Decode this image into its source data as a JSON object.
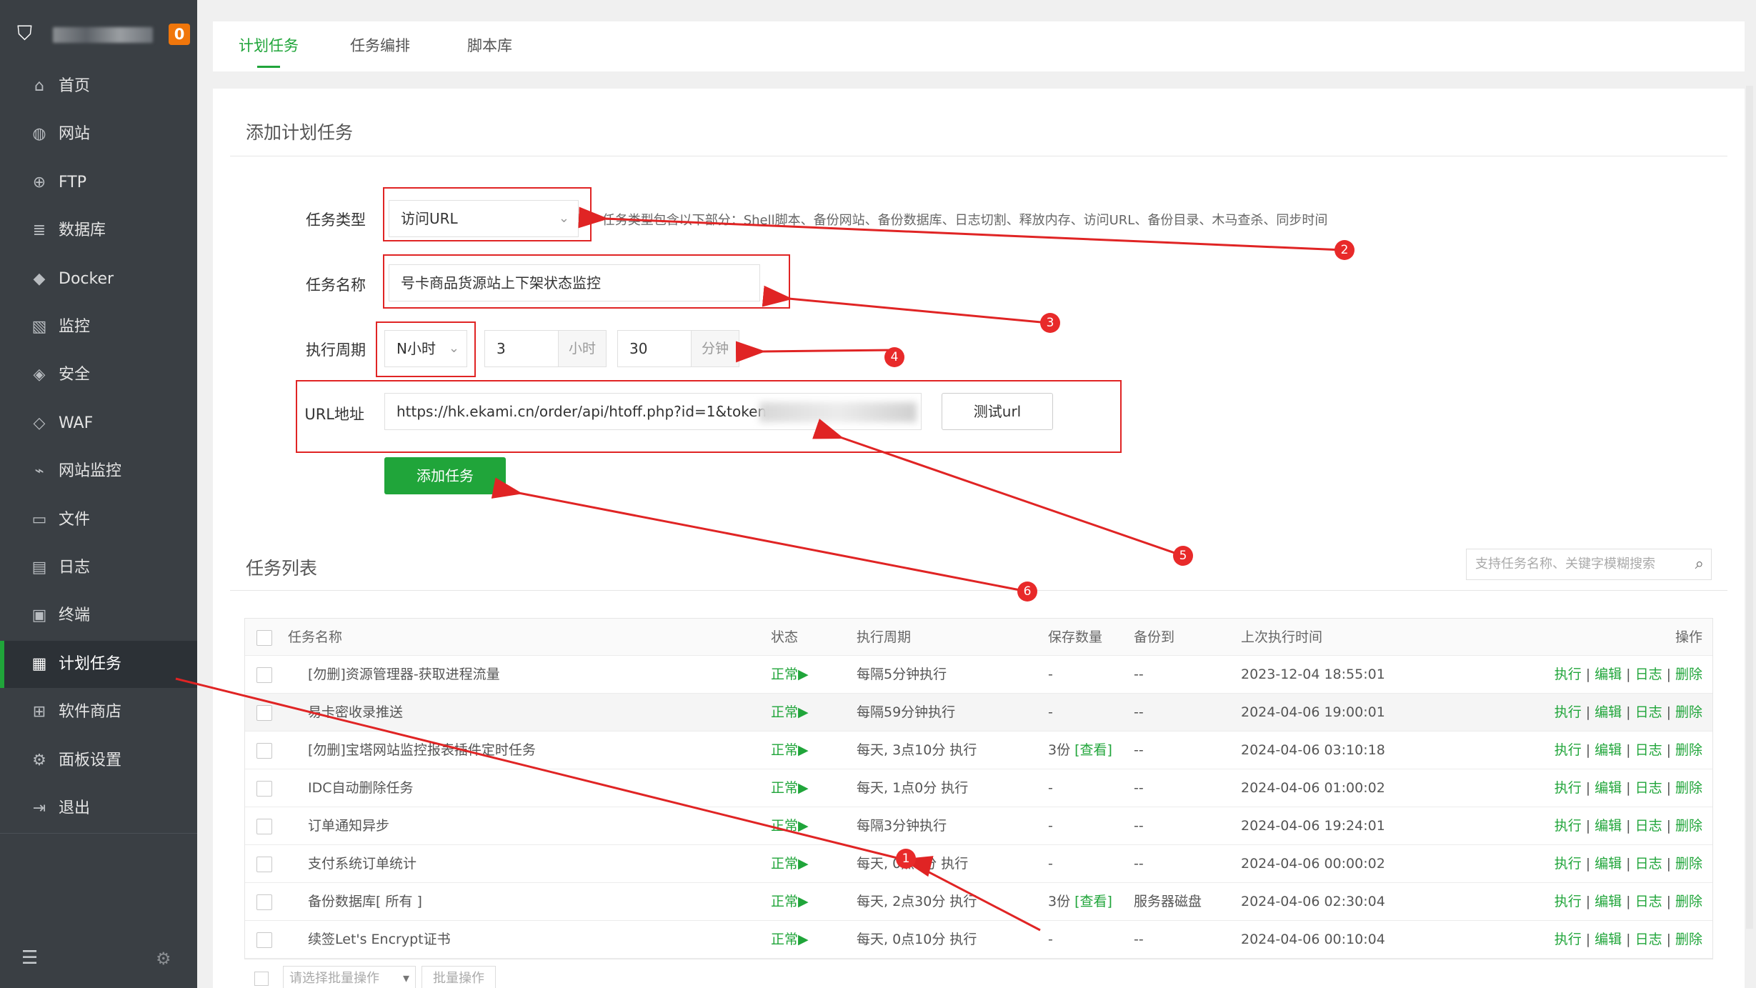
{
  "sidebar": {
    "badge": "0",
    "items": [
      {
        "label": "首页",
        "icon": "home-icon",
        "glyph": "⌂"
      },
      {
        "label": "网站",
        "icon": "globe-icon",
        "glyph": "◍"
      },
      {
        "label": "FTP",
        "icon": "ftp-icon",
        "glyph": "⊕"
      },
      {
        "label": "数据库",
        "icon": "database-icon",
        "glyph": "≣"
      },
      {
        "label": "Docker",
        "icon": "docker-icon",
        "glyph": "◆"
      },
      {
        "label": "监控",
        "icon": "monitor-icon",
        "glyph": "▧"
      },
      {
        "label": "安全",
        "icon": "shield-icon",
        "glyph": "◈"
      },
      {
        "label": "WAF",
        "icon": "waf-icon",
        "glyph": "◇"
      },
      {
        "label": "网站监控",
        "icon": "site-monitor-icon",
        "glyph": "⌁"
      },
      {
        "label": "文件",
        "icon": "folder-icon",
        "glyph": "▭"
      },
      {
        "label": "日志",
        "icon": "log-icon",
        "glyph": "▤"
      },
      {
        "label": "终端",
        "icon": "terminal-icon",
        "glyph": "▣"
      },
      {
        "label": "计划任务",
        "icon": "calendar-icon",
        "glyph": "▦",
        "active": true
      },
      {
        "label": "软件商店",
        "icon": "apps-icon",
        "glyph": "⊞"
      },
      {
        "label": "面板设置",
        "icon": "settings-icon",
        "glyph": "⚙"
      },
      {
        "label": "退出",
        "icon": "logout-icon",
        "glyph": "⇥"
      }
    ]
  },
  "tabs": [
    "计划任务",
    "任务编排",
    "脚本库"
  ],
  "form": {
    "title": "添加计划任务",
    "type_label": "任务类型",
    "type_value": "访问URL",
    "type_hint": "* 任务类型包含以下部分：Shell脚本、备份网站、备份数据库、日志切割、释放内存、访问URL、备份目录、木马查杀、同步时间",
    "name_label": "任务名称",
    "name_value": "号卡商品货源站上下架状态监控",
    "cycle_label": "执行周期",
    "cycle_type": "N小时",
    "hours_value": "3",
    "hours_unit": "小时",
    "minutes_value": "30",
    "minutes_unit": "分钟",
    "url_label": "URL地址",
    "url_value": "https://hk.ekami.cn/order/api/htoff.php?id=1&token=",
    "test_button": "测试url",
    "add_button": "添加任务"
  },
  "list": {
    "title": "任务列表",
    "search_placeholder": "支持任务名称、关键字模糊搜索",
    "columns": [
      "任务名称",
      "状态",
      "执行周期",
      "保存数量",
      "备份到",
      "上次执行时间",
      "操作"
    ],
    "rows": [
      {
        "name": "[勿删]资源管理器-获取进程流量",
        "status": "正常▶",
        "cycle": "每隔5分钟执行",
        "keep": "-",
        "keep_link": "",
        "backup": "--",
        "last": "2023-12-04 18:55:01"
      },
      {
        "name": "易卡密收录推送",
        "status": "正常▶",
        "cycle": "每隔59分钟执行",
        "keep": "-",
        "keep_link": "",
        "backup": "--",
        "last": "2024-04-06 19:00:01"
      },
      {
        "name": "[勿删]宝塔网站监控报表插件定时任务",
        "status": "正常▶",
        "cycle": "每天, 3点10分 执行",
        "keep": "3份",
        "keep_link": "[查看]",
        "backup": "--",
        "last": "2024-04-06 03:10:18"
      },
      {
        "name": "IDC自动删除任务",
        "status": "正常▶",
        "cycle": "每天, 1点0分 执行",
        "keep": "-",
        "keep_link": "",
        "backup": "--",
        "last": "2024-04-06 01:00:02"
      },
      {
        "name": "订单通知异步",
        "status": "正常▶",
        "cycle": "每隔3分钟执行",
        "keep": "-",
        "keep_link": "",
        "backup": "--",
        "last": "2024-04-06 19:24:01"
      },
      {
        "name": "支付系统订单统计",
        "status": "正常▶",
        "cycle": "每天, 0点0分 执行",
        "keep": "-",
        "keep_link": "",
        "backup": "--",
        "last": "2024-04-06 00:00:02"
      },
      {
        "name": "备份数据库[ 所有 ]",
        "status": "正常▶",
        "cycle": "每天, 2点30分 执行",
        "keep": "3份",
        "keep_link": "[查看]",
        "backup": "服务器磁盘",
        "last": "2024-04-06 02:30:04"
      },
      {
        "name": "续签Let's Encrypt证书",
        "status": "正常▶",
        "cycle": "每天, 0点10分 执行",
        "keep": "-",
        "keep_link": "",
        "backup": "--",
        "last": "2024-04-06 00:10:04"
      }
    ],
    "ops": [
      "执行",
      "编辑",
      "日志",
      "删除"
    ],
    "batch_select": "请选择批量操作",
    "batch_button": "批量操作"
  },
  "annotations": [
    "1",
    "2",
    "3",
    "4",
    "5",
    "6"
  ],
  "colors": {
    "accent": "#20a53a",
    "sidebar": "#3a3f44",
    "annotation": "#e02424",
    "badge": "#f0760b"
  }
}
